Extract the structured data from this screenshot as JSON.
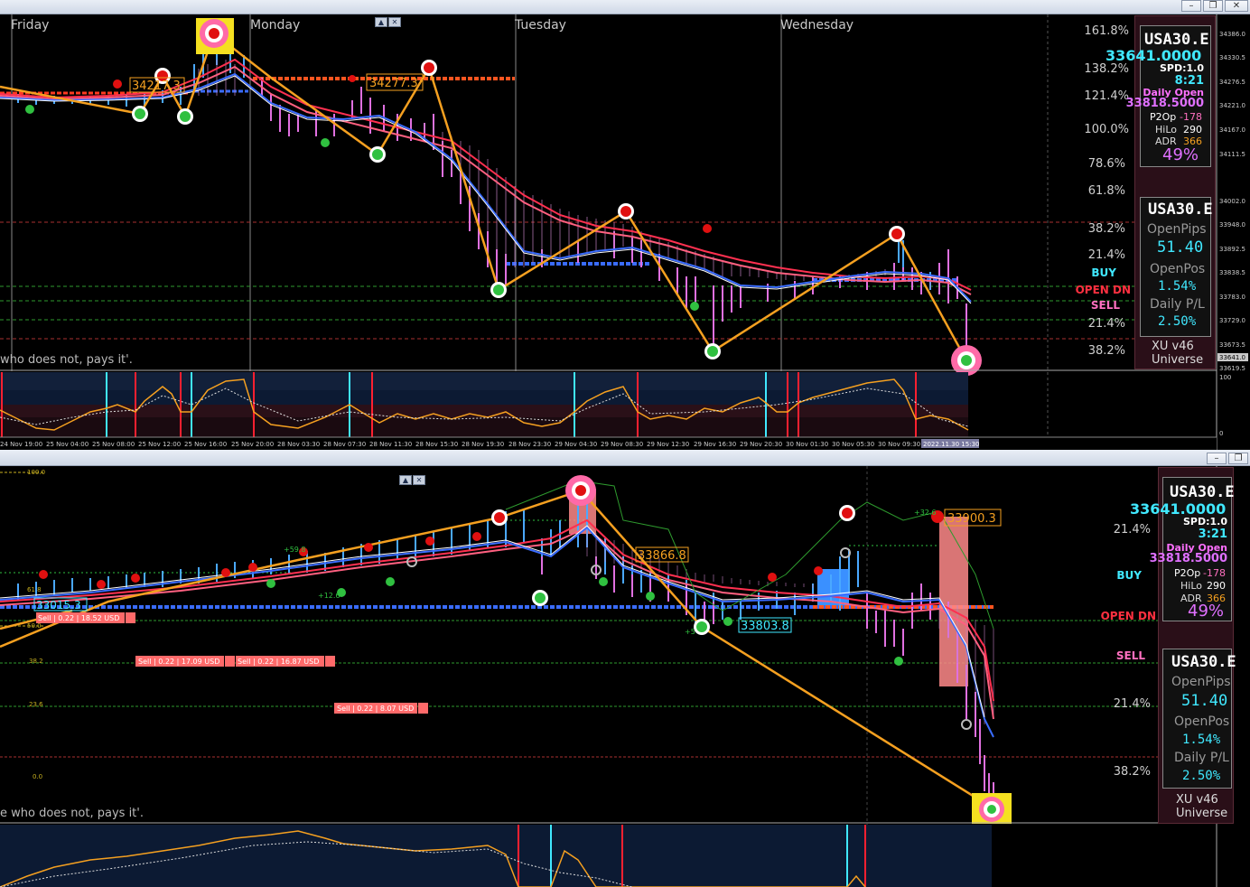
{
  "top": {
    "days": [
      "Friday",
      "Monday",
      "Tuesday",
      "Wednesday"
    ],
    "fib_levels": [
      "161.8%",
      "138.2%",
      "121.4%",
      "100.0%",
      "78.6%",
      "61.8%",
      "38.2%",
      "21.4%",
      "21.4%",
      "38.2%"
    ],
    "signals": {
      "buy": "BUY",
      "open": "OPEN DN",
      "sell": "SELL"
    },
    "price_scale": [
      "34386.0",
      "34330.5",
      "34276.5",
      "34221.0",
      "34167.0",
      "34111.5",
      "34002.0",
      "33948.0",
      "33892.5",
      "33838.5",
      "33783.0",
      "33729.0",
      "33673.5",
      "33619.5",
      "33641.0"
    ],
    "price_labels": [
      "34217.3",
      "34277.3"
    ],
    "quote": "who does not, pays it'.",
    "osc_scale": [
      "100",
      "0"
    ],
    "time_axis": [
      "24 Nov 19:00",
      "25 Nov 04:00",
      "25 Nov 08:00",
      "25 Nov 12:00",
      "25 Nov 16:00",
      "25 Nov 20:00",
      "28 Nov 03:30",
      "28 Nov 07:30",
      "28 Nov 11:30",
      "28 Nov 15:30",
      "28 Nov 19:30",
      "28 Nov 23:30",
      "29 Nov 04:30",
      "29 Nov 08:30",
      "29 Nov 12:30",
      "29 Nov 16:30",
      "29 Nov 20:30",
      "30 Nov 01:30",
      "30 Nov 05:30",
      "30 Nov 09:30",
      "2022.11.30 15:30"
    ]
  },
  "bottom": {
    "fib_levels": [
      "21.4%",
      "21.4%",
      "38.2%"
    ],
    "signals": {
      "buy": "BUY",
      "open": "OPEN DN",
      "sell": "SELL"
    },
    "left_fibs": [
      "100.0",
      "61.8",
      "50.0",
      "38.2",
      "23.6",
      "0.0"
    ],
    "price_labels": [
      "33015.3",
      "33866.8",
      "33803.8",
      "33900.3"
    ],
    "small_labels": [
      "+59.8",
      "+12.6",
      "+32.6",
      "+5"
    ],
    "trades": [
      "Sell | 0.22 | 18.52 USD",
      "Sell | 0.22 | 17.09 USD",
      "Sell | 0.22 | 16.87 USD",
      "Sell | 0.22 | 8.07 USD"
    ],
    "quote": "e who does not, pays it'."
  },
  "info": {
    "symbol": "USA30.E",
    "price": "33641.0000",
    "spd": "SPD:1.0",
    "time_top": "8:21",
    "time_bottom": "3:21",
    "daily_open_label": "Daily Open",
    "daily_open": "33818.5000",
    "p2op_label": "P2Op",
    "p2op": "-178",
    "hilo_label": "HiLo",
    "hilo": "290",
    "adr_label": "ADR",
    "adr": "366",
    "pct": "49%",
    "open_pips_label": "OpenPips",
    "open_pips": "51.40",
    "open_pos_label": "OpenPos",
    "open_pos": "1.54%",
    "daily_pl_label": "Daily P/L",
    "daily_pl": "2.50%",
    "version": "XU v46",
    "universe": "Universe"
  },
  "colors": {
    "bg": "#000000",
    "grid": "#3a3a3a",
    "orange": "#f5a020",
    "red_line": "#ff3050",
    "blue_line": "#3a6cff",
    "cyan": "#40e8ff",
    "magenta": "#e070e0",
    "panel": "#2a0f18",
    "green": "#30c040"
  }
}
